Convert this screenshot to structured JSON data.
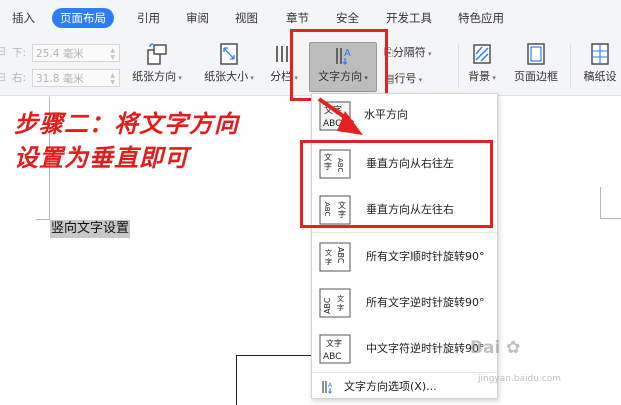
{
  "tabs": [
    "插入",
    "页面布局",
    "引用",
    "审阅",
    "视图",
    "章节",
    "安全",
    "开发工具",
    "特色应用"
  ],
  "margins": {
    "bottom_label": "下:",
    "bottom_value": "25.4 毫米",
    "right_label": "右:",
    "right_value": "31.8 毫米"
  },
  "ribbon": {
    "orientation": "纸张方向",
    "size": "纸张大小",
    "columns": "分栏",
    "text_direction": "文字方向",
    "separator": "分隔符",
    "line_number": "行号",
    "background": "背景",
    "page_border": "页面边框",
    "manuscript": "稿纸设"
  },
  "annotation": {
    "line1": "步骤二：将文字方向",
    "line2": "设置为垂直即可"
  },
  "document": {
    "selected_text": "竖向文字设置"
  },
  "menu": {
    "items": [
      {
        "label": "水平方向",
        "icon": "horizontal-text-icon",
        "glyph": "文字 ABC"
      },
      {
        "label": "垂直方向从右往左",
        "icon": "vertical-rtl-icon",
        "glyph": "ABC 文字"
      },
      {
        "label": "垂直方向从左往右",
        "icon": "vertical-ltr-icon",
        "glyph": "ABC 文字"
      },
      {
        "label": "所有文字顺时针旋转90°",
        "icon": "rotate-cw-icon",
        "glyph": "ABC 文字"
      },
      {
        "label": "所有文字逆时针旋转90°",
        "icon": "rotate-ccw-icon",
        "glyph": "ABC 文字"
      },
      {
        "label": "中文字符逆时针旋转90°",
        "icon": "cjk-rotate-ccw-icon",
        "glyph": "文字 ABC"
      }
    ],
    "options": "文字方向选项(X)..."
  },
  "watermark": {
    "brand": "Bai",
    "url": "jingyan.baidu.com"
  },
  "colors": {
    "active_tab": "#2f7df6",
    "annotation_red": "#e31c1c",
    "ribbon_bg": "#f4f5f7"
  }
}
